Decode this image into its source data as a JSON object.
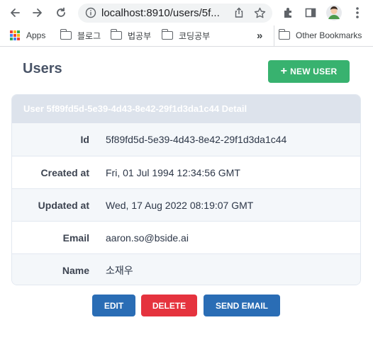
{
  "browser": {
    "url": "localhost:8910/users/5f...",
    "bookmarks": {
      "apps_label": "Apps",
      "items": [
        "블로그",
        "법공부",
        "코딩공부"
      ],
      "overflow": "»",
      "other_label": "Other Bookmarks"
    }
  },
  "page": {
    "title": "Users",
    "new_user_label": "NEW USER",
    "card_title": "User 5f89fd5d-5e39-4d43-8e42-29f1d3da1c44 Detail",
    "fields": [
      {
        "label": "Id",
        "value": "5f89fd5d-5e39-4d43-8e42-29f1d3da1c44"
      },
      {
        "label": "Created at",
        "value": "Fri, 01 Jul 1994 12:34:56 GMT"
      },
      {
        "label": "Updated at",
        "value": "Wed, 17 Aug 2022 08:19:07 GMT"
      },
      {
        "label": "Email",
        "value": "aaron.so@bside.ai"
      },
      {
        "label": "Name",
        "value": "소재우"
      }
    ],
    "actions": {
      "edit": "EDIT",
      "delete": "DELETE",
      "send_email": "SEND EMAIL"
    }
  },
  "colors": {
    "primary": "#2a6db5",
    "danger": "#e5333e",
    "success": "#38b26f",
    "card_header_bg": "#dde3ec"
  }
}
